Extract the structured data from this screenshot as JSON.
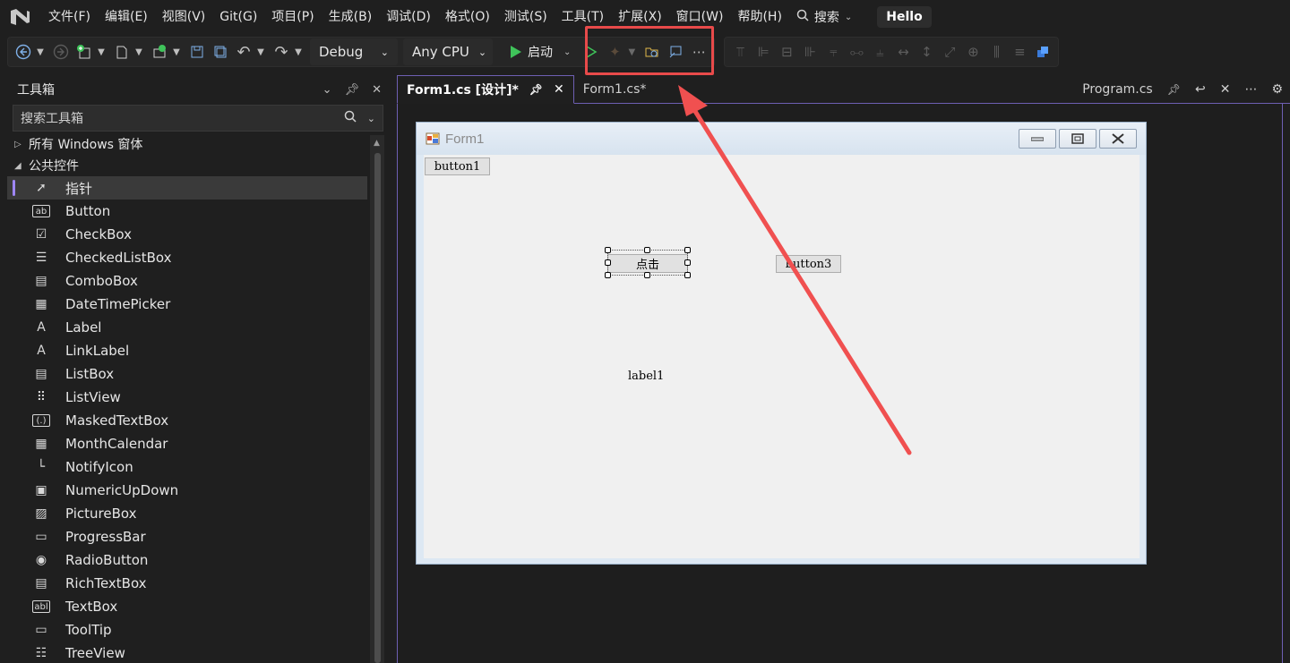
{
  "menubar": {
    "items": [
      "文件(F)",
      "编辑(E)",
      "视图(V)",
      "Git(G)",
      "项目(P)",
      "生成(B)",
      "调试(D)",
      "格式(O)",
      "测试(S)",
      "工具(T)",
      "扩展(X)",
      "窗口(W)",
      "帮助(H)"
    ],
    "search_label": "搜索",
    "solution_name": "Hello"
  },
  "toolbar": {
    "config": "Debug",
    "platform": "Any CPU",
    "start_label": "启动"
  },
  "toolbox": {
    "title": "工具箱",
    "search_placeholder": "搜索工具箱",
    "groups": [
      "所有 Windows 窗体",
      "公共控件"
    ],
    "tools": [
      {
        "label": "指针",
        "icon": "pointer-icon",
        "glyph": "➚"
      },
      {
        "label": "Button",
        "icon": "button-icon",
        "glyph": "ab"
      },
      {
        "label": "CheckBox",
        "icon": "checkbox-icon",
        "glyph": "☑"
      },
      {
        "label": "CheckedListBox",
        "icon": "checkedlistbox-icon",
        "glyph": "☰"
      },
      {
        "label": "ComboBox",
        "icon": "combobox-icon",
        "glyph": "▤"
      },
      {
        "label": "DateTimePicker",
        "icon": "datetimepicker-icon",
        "glyph": "▦"
      },
      {
        "label": "Label",
        "icon": "label-icon",
        "glyph": "A"
      },
      {
        "label": "LinkLabel",
        "icon": "linklabel-icon",
        "glyph": "A"
      },
      {
        "label": "ListBox",
        "icon": "listbox-icon",
        "glyph": "▤"
      },
      {
        "label": "ListView",
        "icon": "listview-icon",
        "glyph": "⠿"
      },
      {
        "label": "MaskedTextBox",
        "icon": "maskedtextbox-icon",
        "glyph": "(.)"
      },
      {
        "label": "MonthCalendar",
        "icon": "monthcalendar-icon",
        "glyph": "▦"
      },
      {
        "label": "NotifyIcon",
        "icon": "notifyicon-icon",
        "glyph": "└"
      },
      {
        "label": "NumericUpDown",
        "icon": "numericupdown-icon",
        "glyph": "▣"
      },
      {
        "label": "PictureBox",
        "icon": "picturebox-icon",
        "glyph": "▨"
      },
      {
        "label": "ProgressBar",
        "icon": "progressbar-icon",
        "glyph": "▭"
      },
      {
        "label": "RadioButton",
        "icon": "radiobutton-icon",
        "glyph": "◉"
      },
      {
        "label": "RichTextBox",
        "icon": "richtextbox-icon",
        "glyph": "▤"
      },
      {
        "label": "TextBox",
        "icon": "textbox-icon",
        "glyph": "abl"
      },
      {
        "label": "ToolTip",
        "icon": "tooltip-icon",
        "glyph": "▭"
      },
      {
        "label": "TreeView",
        "icon": "treeview-icon",
        "glyph": "☷"
      }
    ]
  },
  "tabs": {
    "active": "Form1.cs [设计]*",
    "second": "Form1.cs*",
    "preview": "Program.cs"
  },
  "form": {
    "title": "Form1",
    "button1": "button1",
    "button2": "点击",
    "button3": "button3",
    "label1": "label1"
  },
  "colors": {
    "accent": "#6e5fb3",
    "highlight": "#e84a4a",
    "run_green": "#3fc35a"
  }
}
